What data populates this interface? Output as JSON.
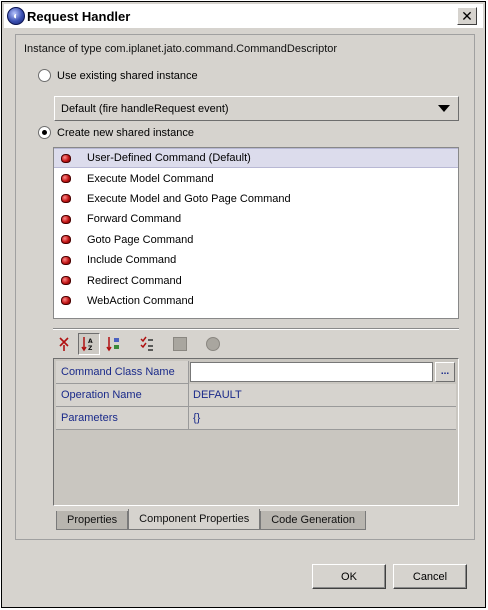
{
  "window": {
    "title": "Request Handler",
    "close_symbol": "✕"
  },
  "section_label": "Instance of type com.iplanet.jato.command.CommandDescriptor",
  "options": {
    "use_existing_label": "Use existing shared instance",
    "create_new_label": "Create new shared instance",
    "selected": "create_new"
  },
  "existing_instance_combo": {
    "value": "Default (fire handleRequest event)"
  },
  "commands": [
    {
      "label": "User-Defined Command (Default)",
      "icon": "command-bean-icon"
    },
    {
      "label": "Execute Model Command",
      "icon": "command-bean-icon"
    },
    {
      "label": "Execute Model and Goto Page Command",
      "icon": "command-bean-icon"
    },
    {
      "label": "Forward Command",
      "icon": "command-bean-icon"
    },
    {
      "label": "Goto Page Command",
      "icon": "command-bean-icon"
    },
    {
      "label": "Include Command",
      "icon": "command-bean-icon"
    },
    {
      "label": "Redirect Command",
      "icon": "command-bean-icon"
    },
    {
      "label": "WebAction Command",
      "icon": "command-bean-icon"
    }
  ],
  "selected_command_index": 0,
  "toolbar": {
    "icons": [
      "sort-unsorted-icon",
      "sort-by-name-icon",
      "sort-by-type-icon",
      "edit-list-icon",
      "stop-icon",
      "record-icon"
    ]
  },
  "properties": {
    "rows": [
      {
        "name": "Command Class Name",
        "value": ""
      },
      {
        "name": "Operation Name",
        "value": "DEFAULT"
      },
      {
        "name": "Parameters",
        "value": "{}"
      }
    ],
    "ellipsis_label": "..."
  },
  "tabs": [
    {
      "label": "Properties",
      "active": false
    },
    {
      "label": "Component Properties",
      "active": true
    },
    {
      "label": "Code Generation",
      "active": false
    }
  ],
  "buttons": {
    "ok": "OK",
    "cancel": "Cancel"
  },
  "colors": {
    "dialog_bg": "#d6d3ce",
    "property_text": "#1a2a8a",
    "selection_bg": "#dcdcec"
  }
}
